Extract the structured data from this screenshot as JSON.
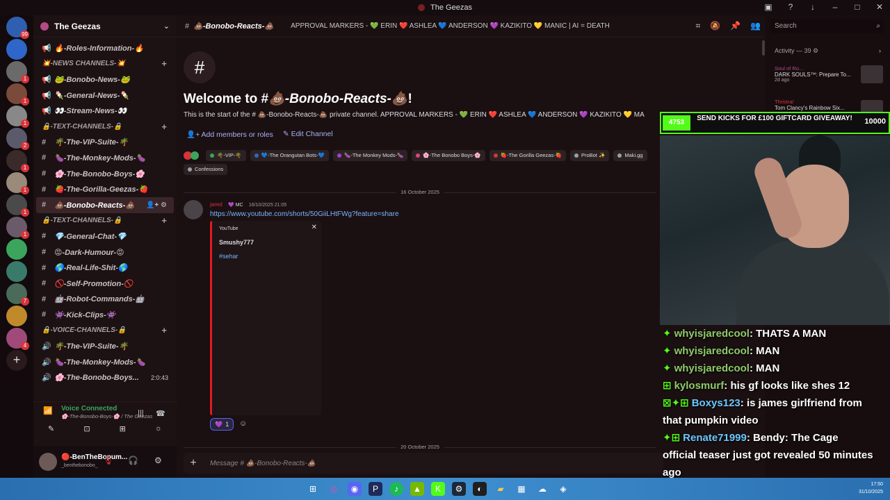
{
  "window": {
    "title": "The Geezas"
  },
  "server_rail": {
    "items": [
      {
        "color": "#2f5fb0",
        "badge": "99"
      },
      {
        "color": "#2f66c9",
        "badge": ""
      },
      {
        "color": "#6a6a6a",
        "badge": "1"
      },
      {
        "color": "#7a4a3a",
        "badge": "1"
      },
      {
        "color": "#888888",
        "badge": "1"
      },
      {
        "color": "#5a5a6a",
        "badge": "2"
      },
      {
        "color": "#3a2a2a",
        "badge": "1"
      },
      {
        "color": "#9a8a7a",
        "badge": "1"
      },
      {
        "color": "#4a4a4a",
        "badge": "1"
      },
      {
        "color": "#6a5a6a",
        "badge": "1"
      },
      {
        "color": "#3ba55d",
        "badge": ""
      },
      {
        "color": "#3a7a6a",
        "badge": ""
      },
      {
        "color": "#4a6a5a",
        "badge": "7"
      },
      {
        "color": "#c08a2a",
        "badge": ""
      },
      {
        "color": "#a04a7a",
        "badge": "4"
      }
    ]
  },
  "sidebar": {
    "guild_name": "The Geezas",
    "rows": [
      {
        "kind": "chan",
        "icon": "📢",
        "label": "🔥-Roles-Information-🔥"
      },
      {
        "kind": "cat",
        "label": "💥-NEWS CHANNELS-💥"
      },
      {
        "kind": "chan",
        "icon": "📢",
        "label": "🐸-Bonobo-News-🐸"
      },
      {
        "kind": "chan",
        "icon": "📢",
        "label": "🍡-General-News-🍡"
      },
      {
        "kind": "chan",
        "icon": "📢",
        "label": "👀-Stream-News-👀"
      },
      {
        "kind": "cat",
        "label": "🔒-TEXT-CHANNELS-🔒"
      },
      {
        "kind": "chan",
        "icon": "#",
        "label": "🌴-The-VIP-Suite-🌴"
      },
      {
        "kind": "chan",
        "icon": "#",
        "label": "🍆-The-Monkey-Mods-🍆"
      },
      {
        "kind": "chan",
        "icon": "#",
        "label": "🌸-The-Bonobo-Boys-🌸"
      },
      {
        "kind": "chan",
        "icon": "#",
        "label": "🍓-The-Gorilla-Geezas-🍓"
      },
      {
        "kind": "chan",
        "icon": "#",
        "label": "💩-Bonobo-Reacts-💩",
        "active": true
      },
      {
        "kind": "cat",
        "label": "🔒-TEXT-CHANNELS-🔒"
      },
      {
        "kind": "chan",
        "icon": "#",
        "label": "💎-General-Chat-💎"
      },
      {
        "kind": "chan",
        "icon": "#",
        "label": "😡-Dark-Humour-😡"
      },
      {
        "kind": "chan",
        "icon": "#",
        "label": "🌎-Real-Life-Shit-🌎"
      },
      {
        "kind": "chan",
        "icon": "#",
        "label": "🚫-Self-Promotion-🚫"
      },
      {
        "kind": "chan",
        "icon": "#",
        "label": "🤖-Robot-Commands-🤖"
      },
      {
        "kind": "chan",
        "icon": "#",
        "label": "👾-Kick-Clips-👾"
      },
      {
        "kind": "cat",
        "label": "🔒-VOICE-CHANNELS-🔒"
      },
      {
        "kind": "chan",
        "icon": "🔊",
        "label": "🌴-The-VIP-Suite-🌴"
      },
      {
        "kind": "chan",
        "icon": "🔊",
        "label": "🍆-The-Monkey-Mods-🍆"
      },
      {
        "kind": "chan",
        "icon": "🔊",
        "label": "🌸-The-Bonobo-Boys...",
        "time": "2:0:43"
      }
    ],
    "voice": {
      "status": "Voice Connected",
      "channel": "🌸-The-Bonobo-Boys-🌸 / The Geezas"
    },
    "user": {
      "name": "🔴-BenTheBopum...",
      "tag": "_benthebonobo_"
    }
  },
  "header": {
    "channel_name": "💩-Bonobo-Reacts-💩",
    "topic": "APPROVAL MARKERS - 💚 ERIN ❤️ ASHLEA 💙 ANDERSON 💜 KAZIKITO 💛 MANIC | AI = DEATH SENTENCE"
  },
  "welcome": {
    "title_prefix": "Welcome to #",
    "title_channel": "💩-Bonobo-Reacts-💩",
    "title_suffix": "!",
    "desc": "This is the start of the # 💩-Bonobo-Reacts-💩 private channel. APPROVAL MARKERS - 💚 ERIN ❤️ ASHLEA 💙 ANDERSON 💜 KAZIKITO 💛 MA",
    "add_members": "Add members or roles",
    "edit_channel": "Edit Channel"
  },
  "roles": [
    {
      "label": "🌴-VIP-🌴",
      "color": "#3ba55d"
    },
    {
      "label": "💙-The Orangutan Bots-💙",
      "color": "#2f66c9"
    },
    {
      "label": "🍆-The Monkey Mods-🍆",
      "color": "#a23fd6"
    },
    {
      "label": "🌸-The Bonobo Boys-🌸",
      "color": "#e0447f"
    },
    {
      "label": "🍓-The Gorilla Geezas-🍓",
      "color": "#d8333a"
    },
    {
      "label": "ProBot ✨",
      "color": "#9aa0a6"
    },
    {
      "label": "Maki.gg",
      "color": "#9aa0a6"
    },
    {
      "label": "Confessions",
      "color": "#9aa0a6"
    }
  ],
  "messages": {
    "date1": "16 October 2025",
    "author": "jared",
    "badge": "💜 MC",
    "timestamp": "16/10/2025 21:05",
    "link": "https://www.youtube.com/shorts/50GiiLHtFWg?feature=share",
    "embed": {
      "provider": "YouTube",
      "title": "Smushy777",
      "desc": "#sehar"
    },
    "reaction": {
      "emoji": "💜",
      "count": "1"
    },
    "date2": "20 October 2025"
  },
  "composer": {
    "placeholder": "Message # 💩-Bonobo-Reacts-💩"
  },
  "activity": {
    "search_placeholder": "Search",
    "title": "Activity — 39 ⚙",
    "items": [
      {
        "who": "Soul of Ro...",
        "text": "DARK SOULS™: Prepare To...",
        "meta": "2d ago"
      },
      {
        "who": "Thristra/",
        "text": "Tom Clancy's Rainbow Six...",
        "meta": ""
      }
    ]
  },
  "overlay": {
    "left_count": "4753",
    "banner": "SEND KICKS FOR £100 GIFTCARD GIVEAWAY!",
    "right_count": "10000"
  },
  "chat": [
    {
      "badge": "✦",
      "user": "whyisjaredcool",
      "text": ": THATS A MAN",
      "color": "green"
    },
    {
      "badge": "✦",
      "user": "whyisjaredcool",
      "text": ": MAN",
      "color": "green"
    },
    {
      "badge": "✦",
      "user": "whyisjaredcool",
      "text": ": MAN",
      "color": "green"
    },
    {
      "badge": "⊞",
      "user": "kylosmurf",
      "text": ": his gf looks like shes 12",
      "color": "green"
    },
    {
      "badge": "⊠✦⊞",
      "user": "Boxys123",
      "text": ": is james girlfriend from",
      "color": "blue"
    },
    {
      "badge": "",
      "user": "",
      "text": "that pumpkin video",
      "color": "blue"
    },
    {
      "badge": "✦⊞",
      "user": "Renate71999",
      "text": ": Bendy: The Cage",
      "color": "blue"
    },
    {
      "badge": "",
      "user": "",
      "text": "official teaser just got revealed 50 minutes",
      "color": "blue"
    },
    {
      "badge": "",
      "user": "",
      "text": "ago",
      "color": "blue"
    }
  ],
  "taskbar": {
    "time": "17:50",
    "date": "31/10/2025"
  }
}
